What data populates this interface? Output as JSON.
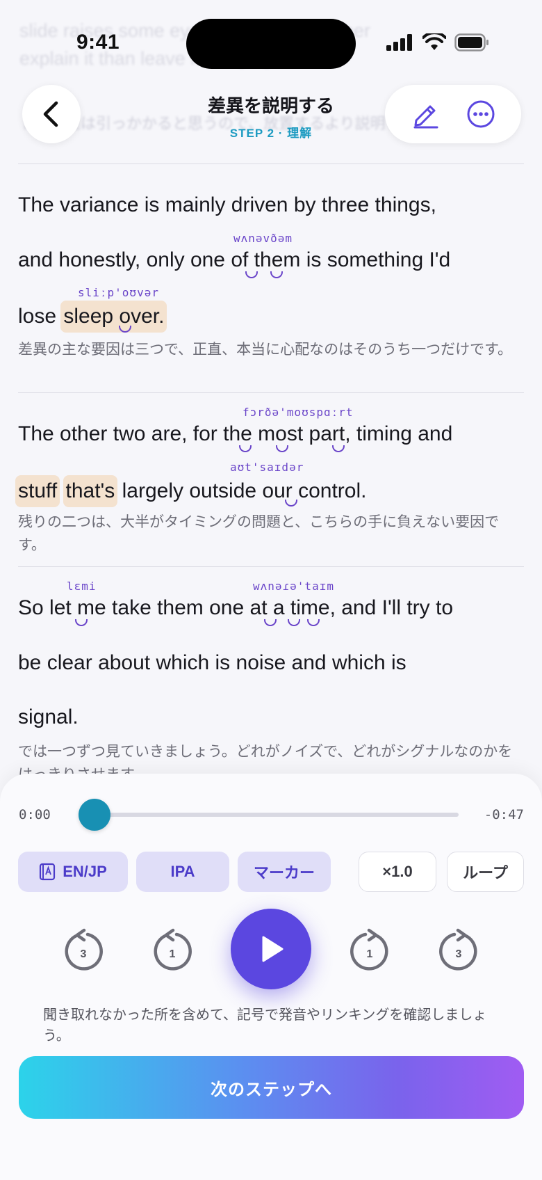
{
  "status_bar": {
    "time": "9:41"
  },
  "ghost": {
    "line1": "slide raises some eyebrows, and I'd rather",
    "line2": "explain it than leave it hanging.",
    "jp": "トの末達は引っかかると思うので、放置するより説明したい。"
  },
  "header": {
    "title": "差異を説明する",
    "subtitle": "STEP 2 · 理解"
  },
  "transcript": [
    {
      "lines": [
        "The variance is mainly driven by three things,",
        "and honestly, only one of them is something I'd",
        "lose sleep over."
      ],
      "ipa": [
        "wʌnəvðəm",
        "sliːp'oʊvər"
      ],
      "translation": "差異の主な要因は三つで、正直、本当に心配なのはそのうち一つだけです。"
    },
    {
      "lines": [
        "The other two are, for the most part, timing and",
        "stuff that's largely outside our control."
      ],
      "ipa": [
        "fɔrðə'moʊspɑːrt",
        "aʊt'saɪdər"
      ],
      "translation": "残りの二つは、大半がタイミングの問題と、こちらの手に負えない要因です。"
    },
    {
      "lines": [
        "So let me take them one at a time, and I'll try to",
        "be clear about which is noise and which is",
        "signal."
      ],
      "ipa": [
        "lɛmi",
        "wʌnəɾə'taɪm"
      ],
      "translation": "では一つずつ見ていきましょう。どれがノイズで、どれがシグナルなのかをはっきりさせます。"
    }
  ],
  "player": {
    "current_time": "0:00",
    "remaining_time": "-0:47",
    "progress": 0.0,
    "chips": {
      "en_jp": "EN/JP",
      "ipa": "IPA",
      "marker": "マーカー",
      "speed": "×1.0",
      "loop": "ループ"
    },
    "skip_back_3": "3",
    "skip_back_1": "1",
    "skip_fwd_1": "1",
    "skip_fwd_3": "3",
    "accent": "#5b47e0"
  },
  "hint": "聞き取れなかった所を含めて、記号で発音やリンキングを確認しましょう。",
  "cta_label": "次のステップへ"
}
